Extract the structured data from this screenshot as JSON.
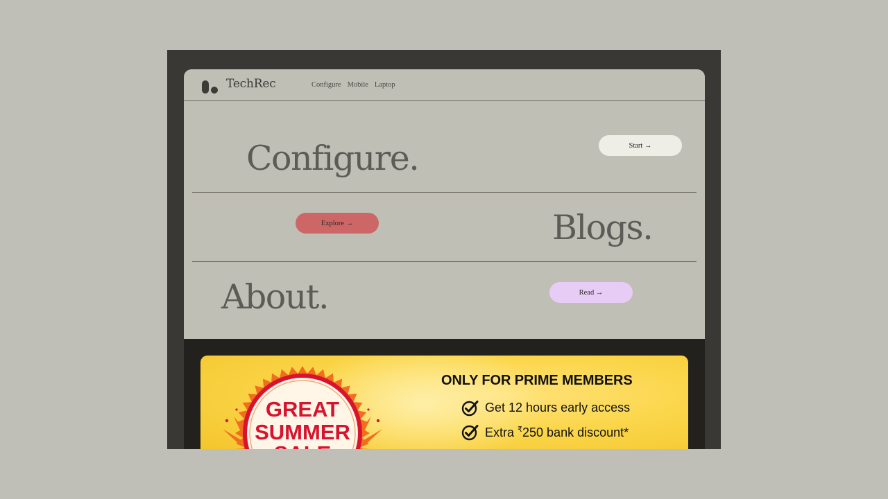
{
  "brand": {
    "name": "TechRec",
    "logo_icon": "pill-dot-logo-icon"
  },
  "nav": [
    {
      "label": "Configure"
    },
    {
      "label": "Mobile"
    },
    {
      "label": "Laptop"
    }
  ],
  "sections": {
    "configure": {
      "title": "Configure.",
      "button": "Start →",
      "button_color": "#eeede6"
    },
    "blogs": {
      "title": "Blogs.",
      "button": "Explore →",
      "button_color": "#cd6767"
    },
    "about": {
      "title": "About.",
      "button": "Read →",
      "button_color": "#e7ccf5"
    }
  },
  "banner": {
    "sale_line1": "GREAT",
    "sale_line2": "SUMMER",
    "sale_line3": "SALE",
    "headline": "ONLY FOR PRIME MEMBERS",
    "perk1": "Get 12 hours early access",
    "perk2_prefix": "Extra ",
    "perk2_currency": "₹",
    "perk2_rest": "250 bank discount*",
    "check_icon": "check-circle-icon",
    "colors": {
      "background": "#fbd64a",
      "sale_red": "#d8132e",
      "ring_orange": "#f26d1e"
    }
  },
  "colors": {
    "page_background": "#c0bfb7",
    "frame": "#3a3834",
    "card": "#c0bfb6",
    "lower_panel": "#23211e",
    "heading_text": "#5c5b55"
  }
}
